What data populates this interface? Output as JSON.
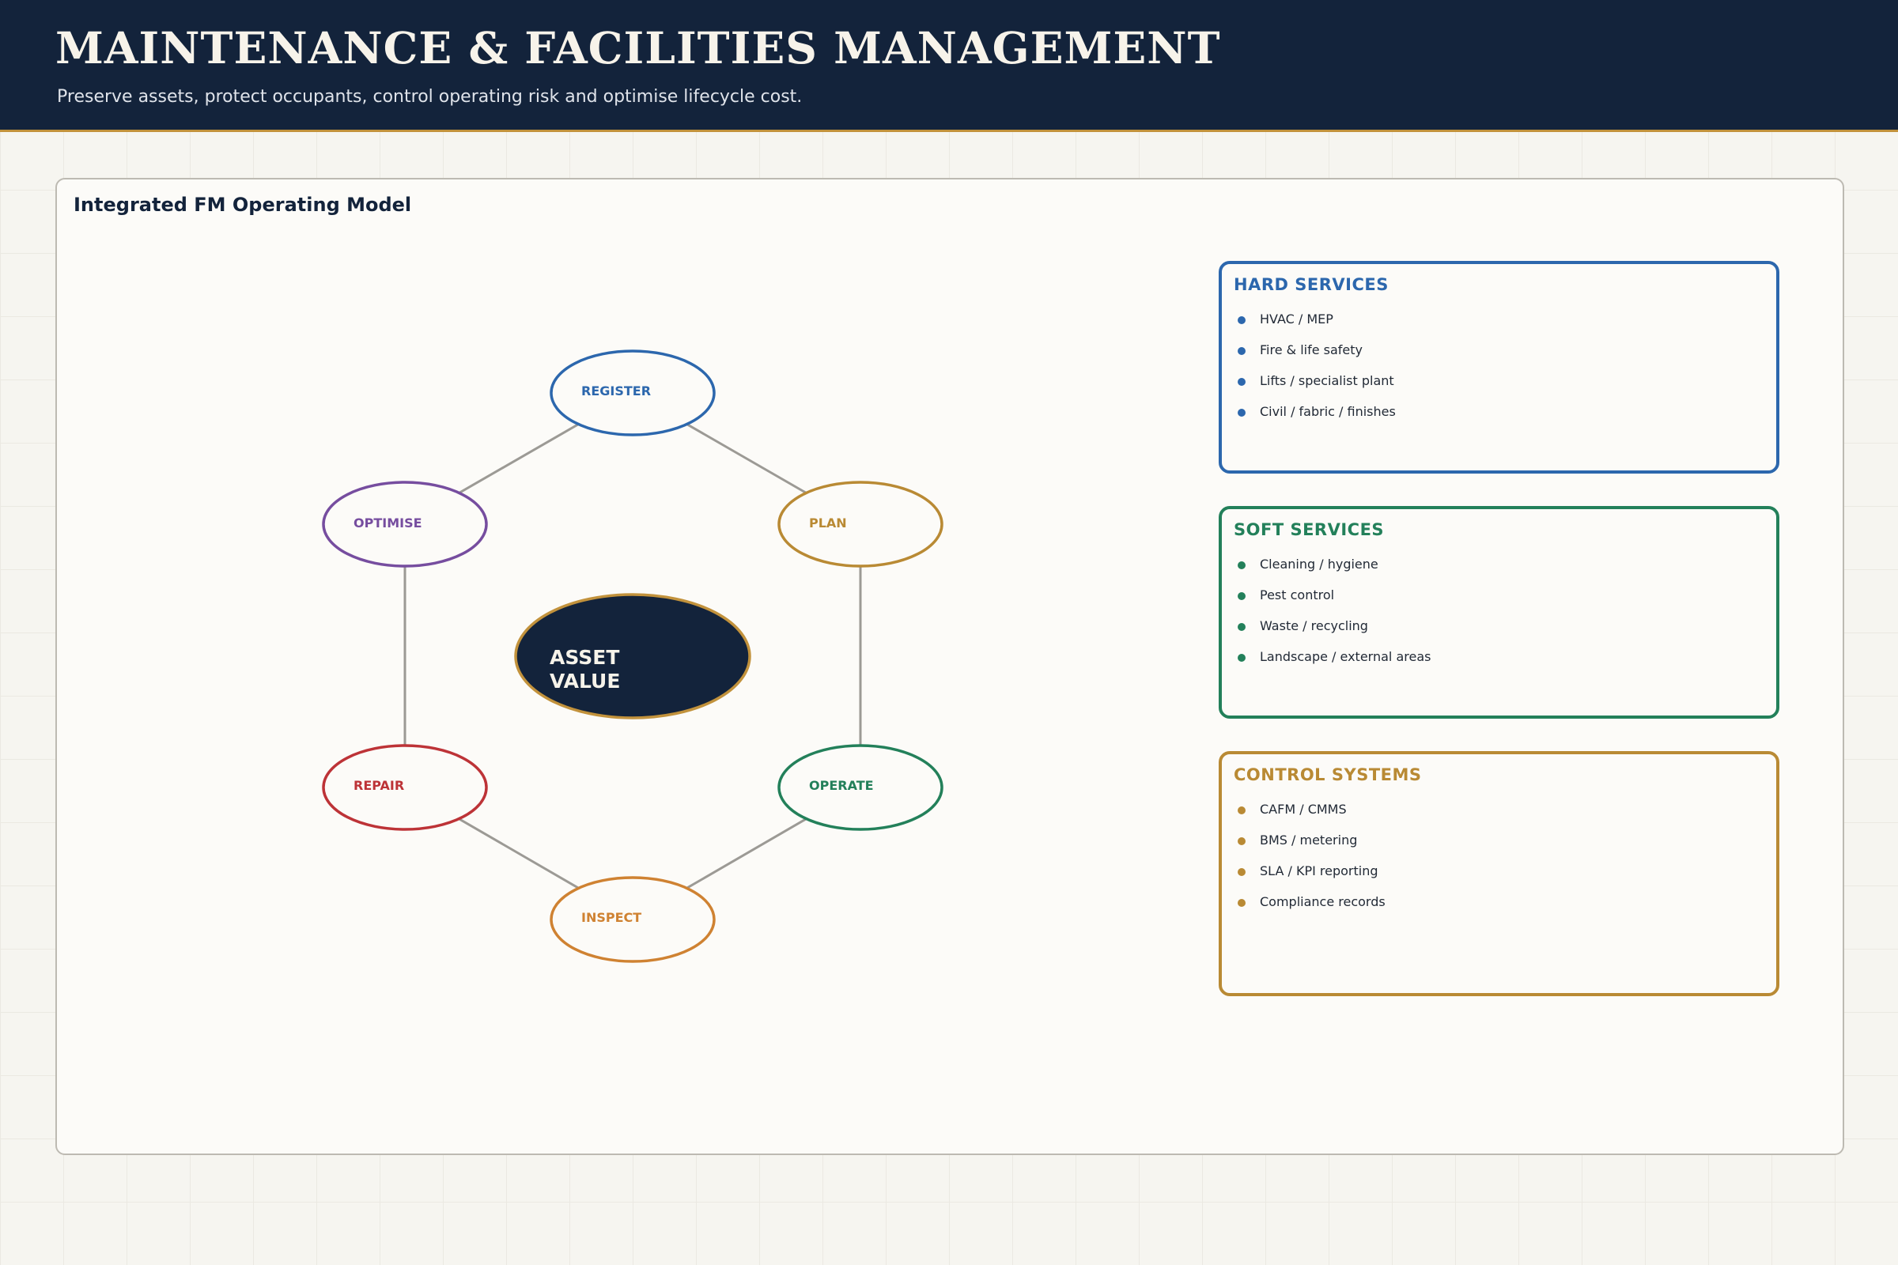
{
  "header": {
    "title": "MAINTENANCE & FACILITIES MANAGEMENT",
    "subtitle": "Preserve assets, protect occupants, control operating risk and optimise lifecycle cost."
  },
  "panel": {
    "title": "Integrated FM Operating Model"
  },
  "cycle": {
    "center": {
      "line1": "ASSET",
      "line2": "VALUE",
      "fill": "#13233b",
      "stroke": "#c2923c"
    },
    "connector_color": "#9c9a95",
    "nodes": [
      {
        "label": "REGISTER",
        "color": "#2c67ad"
      },
      {
        "label": "PLAN",
        "color": "#b98a34"
      },
      {
        "label": "OPERATE",
        "color": "#23805a"
      },
      {
        "label": "INSPECT",
        "color": "#cf8232"
      },
      {
        "label": "REPAIR",
        "color": "#bd3337"
      },
      {
        "label": "OPTIMISE",
        "color": "#764d9f"
      }
    ]
  },
  "services": [
    {
      "title": "HARD SERVICES",
      "color": "#2c67ad",
      "items": [
        "HVAC / MEP",
        "Fire & life safety",
        "Lifts / specialist plant",
        "Civil / fabric / finishes"
      ]
    },
    {
      "title": "SOFT SERVICES",
      "color": "#23805a",
      "items": [
        "Cleaning / hygiene",
        "Pest control",
        "Waste / recycling",
        "Landscape / external areas"
      ]
    },
    {
      "title": "CONTROL SYSTEMS",
      "color": "#b98a34",
      "items": [
        "CAFM / CMMS",
        "BMS / metering",
        "SLA / KPI reporting",
        "Compliance records"
      ]
    }
  ]
}
